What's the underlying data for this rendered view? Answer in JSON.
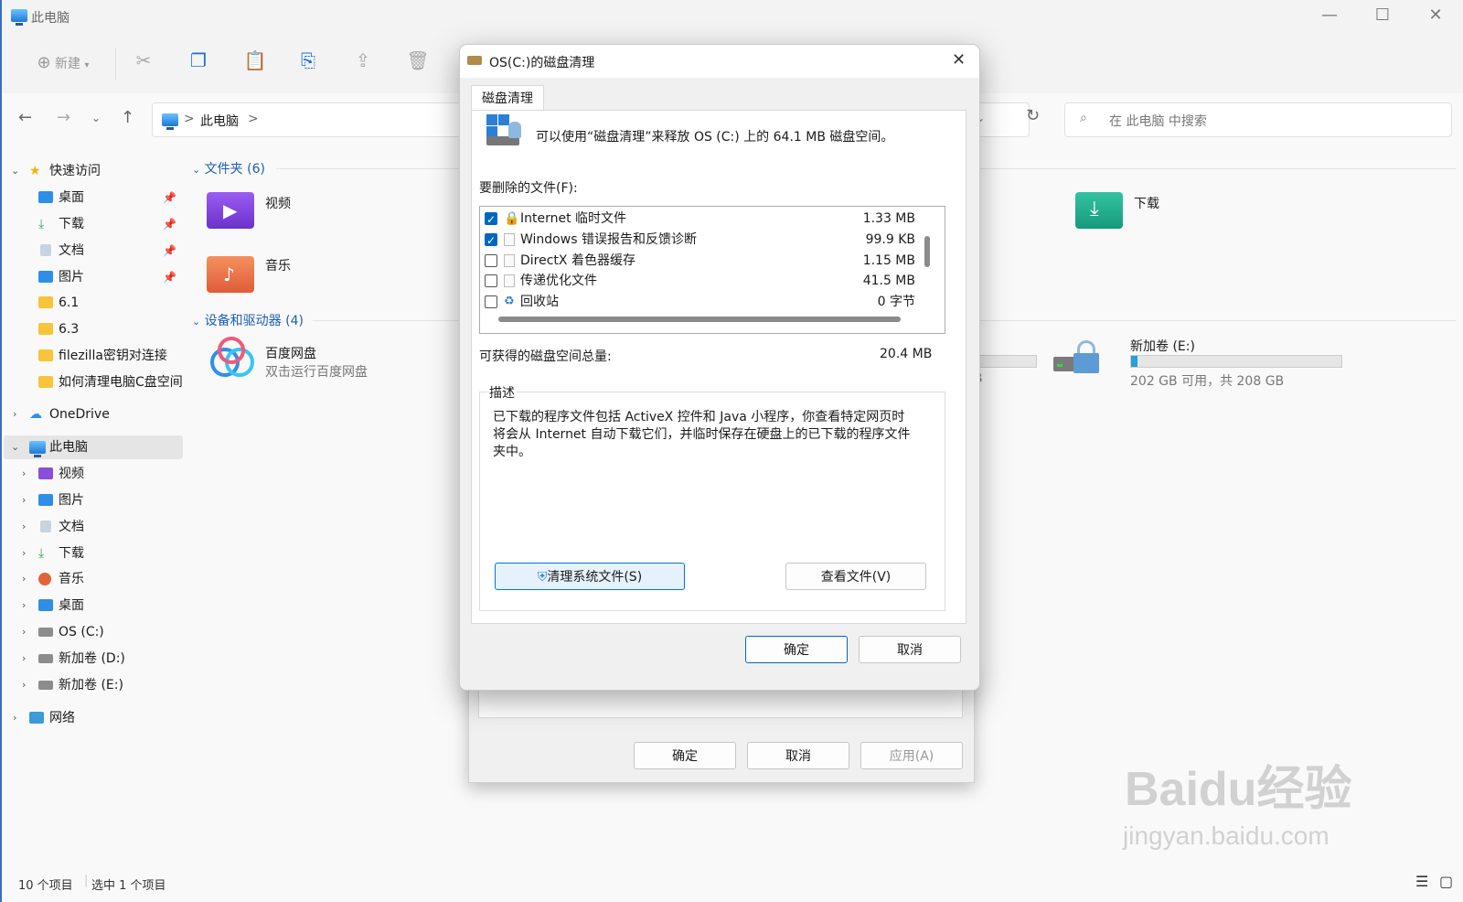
{
  "explorer": {
    "title": "此电脑",
    "toolbar": {
      "new_label": "新建"
    },
    "address": {
      "path_root": "此电脑",
      "sep": ">"
    },
    "search": {
      "placeholder": "在 此电脑 中搜索"
    },
    "sidebar": {
      "quick_access": "快速访问",
      "items": [
        {
          "label": "桌面"
        },
        {
          "label": "下载"
        },
        {
          "label": "文档"
        },
        {
          "label": "图片"
        },
        {
          "label": "6.1"
        },
        {
          "label": "6.3"
        },
        {
          "label": "filezilla密钥对连接"
        },
        {
          "label": "如何清理电脑C盘空间"
        }
      ],
      "onedrive": "OneDrive",
      "this_pc": "此电脑",
      "pc_children": [
        {
          "label": "视频"
        },
        {
          "label": "图片"
        },
        {
          "label": "文档"
        },
        {
          "label": "下载"
        },
        {
          "label": "音乐"
        },
        {
          "label": "桌面"
        },
        {
          "label": "OS (C:)"
        },
        {
          "label": "新加卷 (D:)"
        },
        {
          "label": "新加卷 (E:)"
        }
      ],
      "network": "网络"
    },
    "content": {
      "folders_header": "文件夹 (6)",
      "folders": [
        {
          "label": "视频"
        },
        {
          "label": "音乐"
        },
        {
          "label": "下载"
        }
      ],
      "devices_header": "设备和驱动器 (4)",
      "baidu": {
        "label": "百度网盘",
        "sub": "双击运行百度网盘"
      },
      "partial_drive_sub": "GB",
      "drive_e": {
        "label": "新加卷 (E:)",
        "sub": "202 GB 可用，共 208 GB",
        "used_fraction": 0.03
      }
    },
    "status": {
      "count": "10 个项目",
      "selected": "选中 1 个项目"
    }
  },
  "properties_dialog": {
    "ok": "确定",
    "cancel": "取消",
    "apply": "应用(A)"
  },
  "cleanup_dialog": {
    "title": "OS(C:)的磁盘清理",
    "tab": "磁盘清理",
    "intro": "可以使用“磁盘清理”来释放 OS (C:) 上的 64.1 MB 磁盘空间。",
    "files_label": "要删除的文件(F):",
    "files": [
      {
        "name": "Internet 临时文件",
        "size": "1.33 MB",
        "checked": true
      },
      {
        "name": "Windows 错误报告和反馈诊断",
        "size": "99.9 KB",
        "checked": true
      },
      {
        "name": "DirectX 着色器缓存",
        "size": "1.15 MB",
        "checked": false
      },
      {
        "name": "传递优化文件",
        "size": "41.5 MB",
        "checked": false
      },
      {
        "name": "回收站",
        "size": "0 字节",
        "checked": false
      }
    ],
    "total_label": "可获得的磁盘空间总量:",
    "total_value": "20.4 MB",
    "desc_label": "描述",
    "description": "已下载的程序文件包括 ActiveX 控件和 Java 小程序，你查看特定网页时将会从 Internet 自动下载它们，并临时保存在硬盘上的已下载的程序文件夹中。",
    "clean_system_button": "清理系统文件(S)",
    "view_files_button": "查看文件(V)",
    "ok": "确定",
    "cancel": "取消"
  },
  "watermark": {
    "line1": "Baidu经验",
    "line2": "jingyan.baidu.com"
  }
}
